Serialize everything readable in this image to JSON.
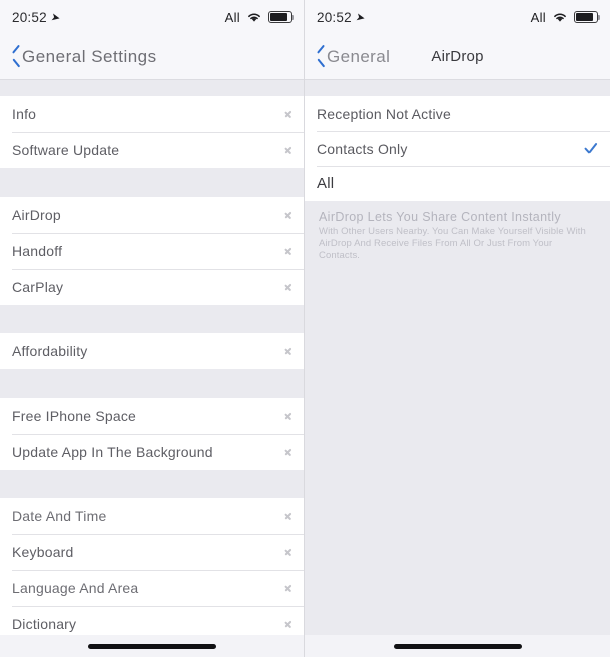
{
  "status_bar": {
    "time": "20:52",
    "location_icon": "location-arrow-icon",
    "carrier": "All",
    "wifi_icon": "wifi-icon",
    "battery_icon": "battery-icon"
  },
  "left_screen": {
    "nav": {
      "back_icon": "chevron-left-icon",
      "title": "General Settings"
    },
    "sections": [
      {
        "rows": [
          {
            "label": "Info",
            "accessory": "chevron-right-icon"
          },
          {
            "label": "Software Update",
            "accessory": "chevron-right-icon"
          }
        ]
      },
      {
        "rows": [
          {
            "label": "AirDrop",
            "accessory": "chevron-right-icon"
          },
          {
            "label": "Handoff",
            "accessory": "chevron-right-icon"
          },
          {
            "label": "CarPlay",
            "accessory": "chevron-right-icon"
          }
        ]
      },
      {
        "rows": [
          {
            "label": "Affordability",
            "accessory": "chevron-right-icon"
          }
        ]
      },
      {
        "rows": [
          {
            "label": "Free IPhone Space",
            "accessory": "chevron-right-icon"
          },
          {
            "label": "Update App In The Background",
            "accessory": "chevron-right-icon"
          }
        ]
      },
      {
        "rows": [
          {
            "label": "Date And Time",
            "accessory": "chevron-right-icon"
          },
          {
            "label": "Keyboard",
            "accessory": "chevron-right-icon"
          },
          {
            "label": "Language And Area",
            "accessory": "chevron-right-icon"
          },
          {
            "label": "Dictionary",
            "accessory": "chevron-right-icon"
          }
        ]
      }
    ]
  },
  "right_screen": {
    "nav": {
      "back_icon": "chevron-left-icon",
      "back_label": "General",
      "title": "AirDrop"
    },
    "options": [
      {
        "label": "Reception Not Active",
        "selected": false
      },
      {
        "label": "Contacts Only",
        "selected": true
      },
      {
        "label": "All",
        "selected": false
      }
    ],
    "footer": {
      "heading": "AirDrop Lets You Share Content Instantly",
      "body": "With Other Users Nearby. You Can Make Yourself Visible With AirDrop And Receive Files From All Or Just From Your Contacts."
    }
  },
  "colors": {
    "accent_blue": "#3c79cf",
    "back_blue": "#2f6fd0",
    "group_bg": "#ffffff",
    "page_bg": "#eaeaef",
    "nav_bg": "#f7f7fa"
  },
  "home_indicator": "home-indicator-bar"
}
